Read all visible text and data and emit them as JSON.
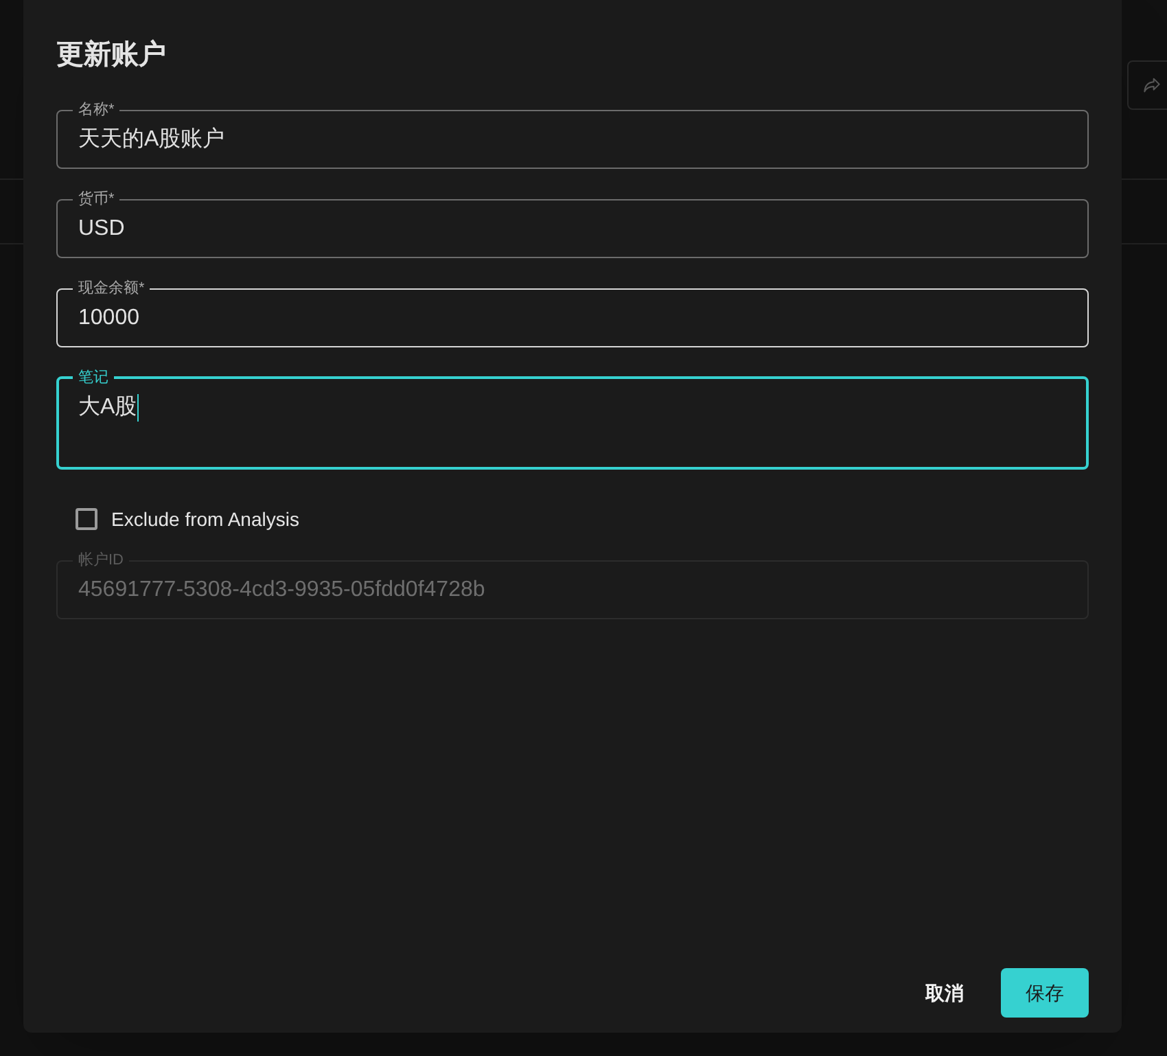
{
  "dialog": {
    "title": "更新账户"
  },
  "form": {
    "items": [
      {
        "kind": "text",
        "label": "名称*",
        "value": "天天的A股账户",
        "focused": false,
        "hovered": false,
        "disabled": false
      },
      {
        "kind": "text",
        "label": "货币*",
        "value": "USD",
        "focused": false,
        "hovered": false,
        "disabled": false
      },
      {
        "kind": "text",
        "label": "现金余额*",
        "value": "10000",
        "focused": false,
        "hovered": true,
        "disabled": false
      },
      {
        "kind": "multiline",
        "label": "笔记",
        "value": "大A股",
        "focused": true,
        "hovered": false,
        "disabled": false
      },
      {
        "kind": "checkbox",
        "label": "Exclude from Analysis",
        "checked": false
      },
      {
        "kind": "text",
        "label": "帐户ID",
        "value": "45691777-5308-4cd3-9935-05fdd0f4728b",
        "focused": false,
        "hovered": false,
        "disabled": true
      }
    ]
  },
  "buttons": [
    {
      "label": "取消",
      "kind": "text"
    },
    {
      "label": "保存",
      "kind": "primary"
    }
  ]
}
